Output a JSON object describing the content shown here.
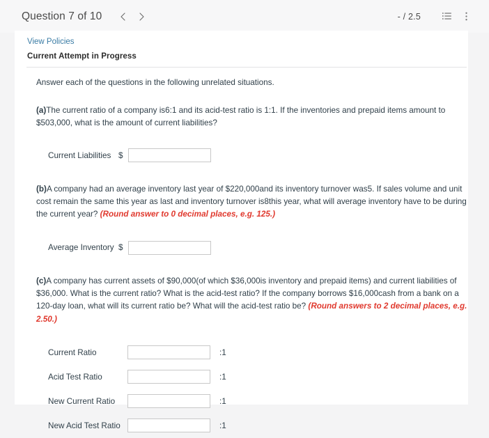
{
  "header": {
    "question_title": "Question 7 of 10",
    "prev_label": "Previous question",
    "next_label": "Next question",
    "score": "- / 2.5",
    "list_icon_label": "Question list",
    "more_icon_label": "More options"
  },
  "card": {
    "view_policies": "View Policies",
    "attempt_status": "Current Attempt in Progress",
    "intro": "Answer each of the questions in the following unrelated situations."
  },
  "parts": {
    "a": {
      "letter": "(a)",
      "text": "The current ratio of a company is6:1 and its acid-test ratio is 1:1. If the inventories and prepaid items amount to $503,000, what is the amount of current liabilities?",
      "rows": [
        {
          "label": "Current Liabilities",
          "prefix": "$",
          "value": "",
          "suffix": ""
        }
      ]
    },
    "b": {
      "letter": "(b)",
      "text": "A company had an average inventory last year of $220,000and its inventory turnover was5. If sales volume and unit cost remain the same this year as last and inventory turnover is8this year, what will average inventory have to be during the current year? ",
      "hint": "(Round answer to 0 decimal places, e.g. 125.)",
      "rows": [
        {
          "label": "Average Inventory",
          "prefix": "$",
          "value": "",
          "suffix": ""
        }
      ]
    },
    "c": {
      "letter": "(c)",
      "text": "A company has current assets of $90,000(of which $36,000is inventory and prepaid items) and current liabilities of $36,000. What is the current ratio? What is the acid-test ratio? If the company borrows $16,000cash from a bank on a 120-day loan, what will its current ratio be? What will the acid-test ratio be? ",
      "hint": "(Round answers to 2 decimal places, e.g. 2.50.)",
      "rows": [
        {
          "label": "Current Ratio",
          "prefix": "",
          "value": "",
          "suffix": ":1"
        },
        {
          "label": "Acid Test Ratio",
          "prefix": "",
          "value": "",
          "suffix": ":1"
        },
        {
          "label": "New Current Ratio",
          "prefix": "",
          "value": "",
          "suffix": ":1"
        },
        {
          "label": "New Acid Test Ratio",
          "prefix": "",
          "value": "",
          "suffix": ":1"
        }
      ]
    }
  },
  "colors": {
    "hint_red": "#e0392e",
    "link_blue": "#3a7ca5",
    "page_bg": "#f4f4f5",
    "card_bg": "#ffffff"
  }
}
